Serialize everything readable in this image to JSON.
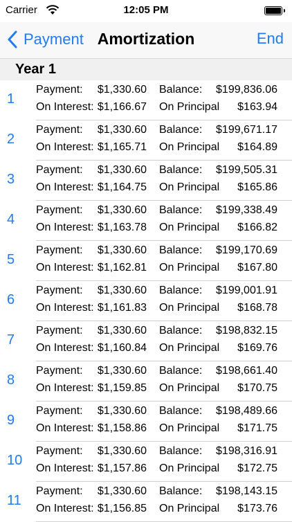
{
  "status_bar": {
    "carrier": "Carrier",
    "time": "12:05 PM"
  },
  "nav": {
    "back_label": "Payment",
    "title": "Amortization",
    "end_label": "End"
  },
  "section": {
    "title": "Year 1"
  },
  "labels": {
    "payment": "Payment:",
    "balance": "Balance:",
    "on_interest": "On Interest:",
    "on_principal": "On Principal"
  },
  "rows": [
    {
      "num": "1",
      "payment": "$1,330.60",
      "balance": "$199,836.06",
      "interest": "$1,166.67",
      "principal": "$163.94"
    },
    {
      "num": "2",
      "payment": "$1,330.60",
      "balance": "$199,671.17",
      "interest": "$1,165.71",
      "principal": "$164.89"
    },
    {
      "num": "3",
      "payment": "$1,330.60",
      "balance": "$199,505.31",
      "interest": "$1,164.75",
      "principal": "$165.86"
    },
    {
      "num": "4",
      "payment": "$1,330.60",
      "balance": "$199,338.49",
      "interest": "$1,163.78",
      "principal": "$166.82"
    },
    {
      "num": "5",
      "payment": "$1,330.60",
      "balance": "$199,170.69",
      "interest": "$1,162.81",
      "principal": "$167.80"
    },
    {
      "num": "6",
      "payment": "$1,330.60",
      "balance": "$199,001.91",
      "interest": "$1,161.83",
      "principal": "$168.78"
    },
    {
      "num": "7",
      "payment": "$1,330.60",
      "balance": "$198,832.15",
      "interest": "$1,160.84",
      "principal": "$169.76"
    },
    {
      "num": "8",
      "payment": "$1,330.60",
      "balance": "$198,661.40",
      "interest": "$1,159.85",
      "principal": "$170.75"
    },
    {
      "num": "9",
      "payment": "$1,330.60",
      "balance": "$198,489.66",
      "interest": "$1,158.86",
      "principal": "$171.75"
    },
    {
      "num": "10",
      "payment": "$1,330.60",
      "balance": "$198,316.91",
      "interest": "$1,157.86",
      "principal": "$172.75"
    },
    {
      "num": "11",
      "payment": "$1,330.60",
      "balance": "$198,143.15",
      "interest": "$1,156.85",
      "principal": "$173.76"
    }
  ]
}
